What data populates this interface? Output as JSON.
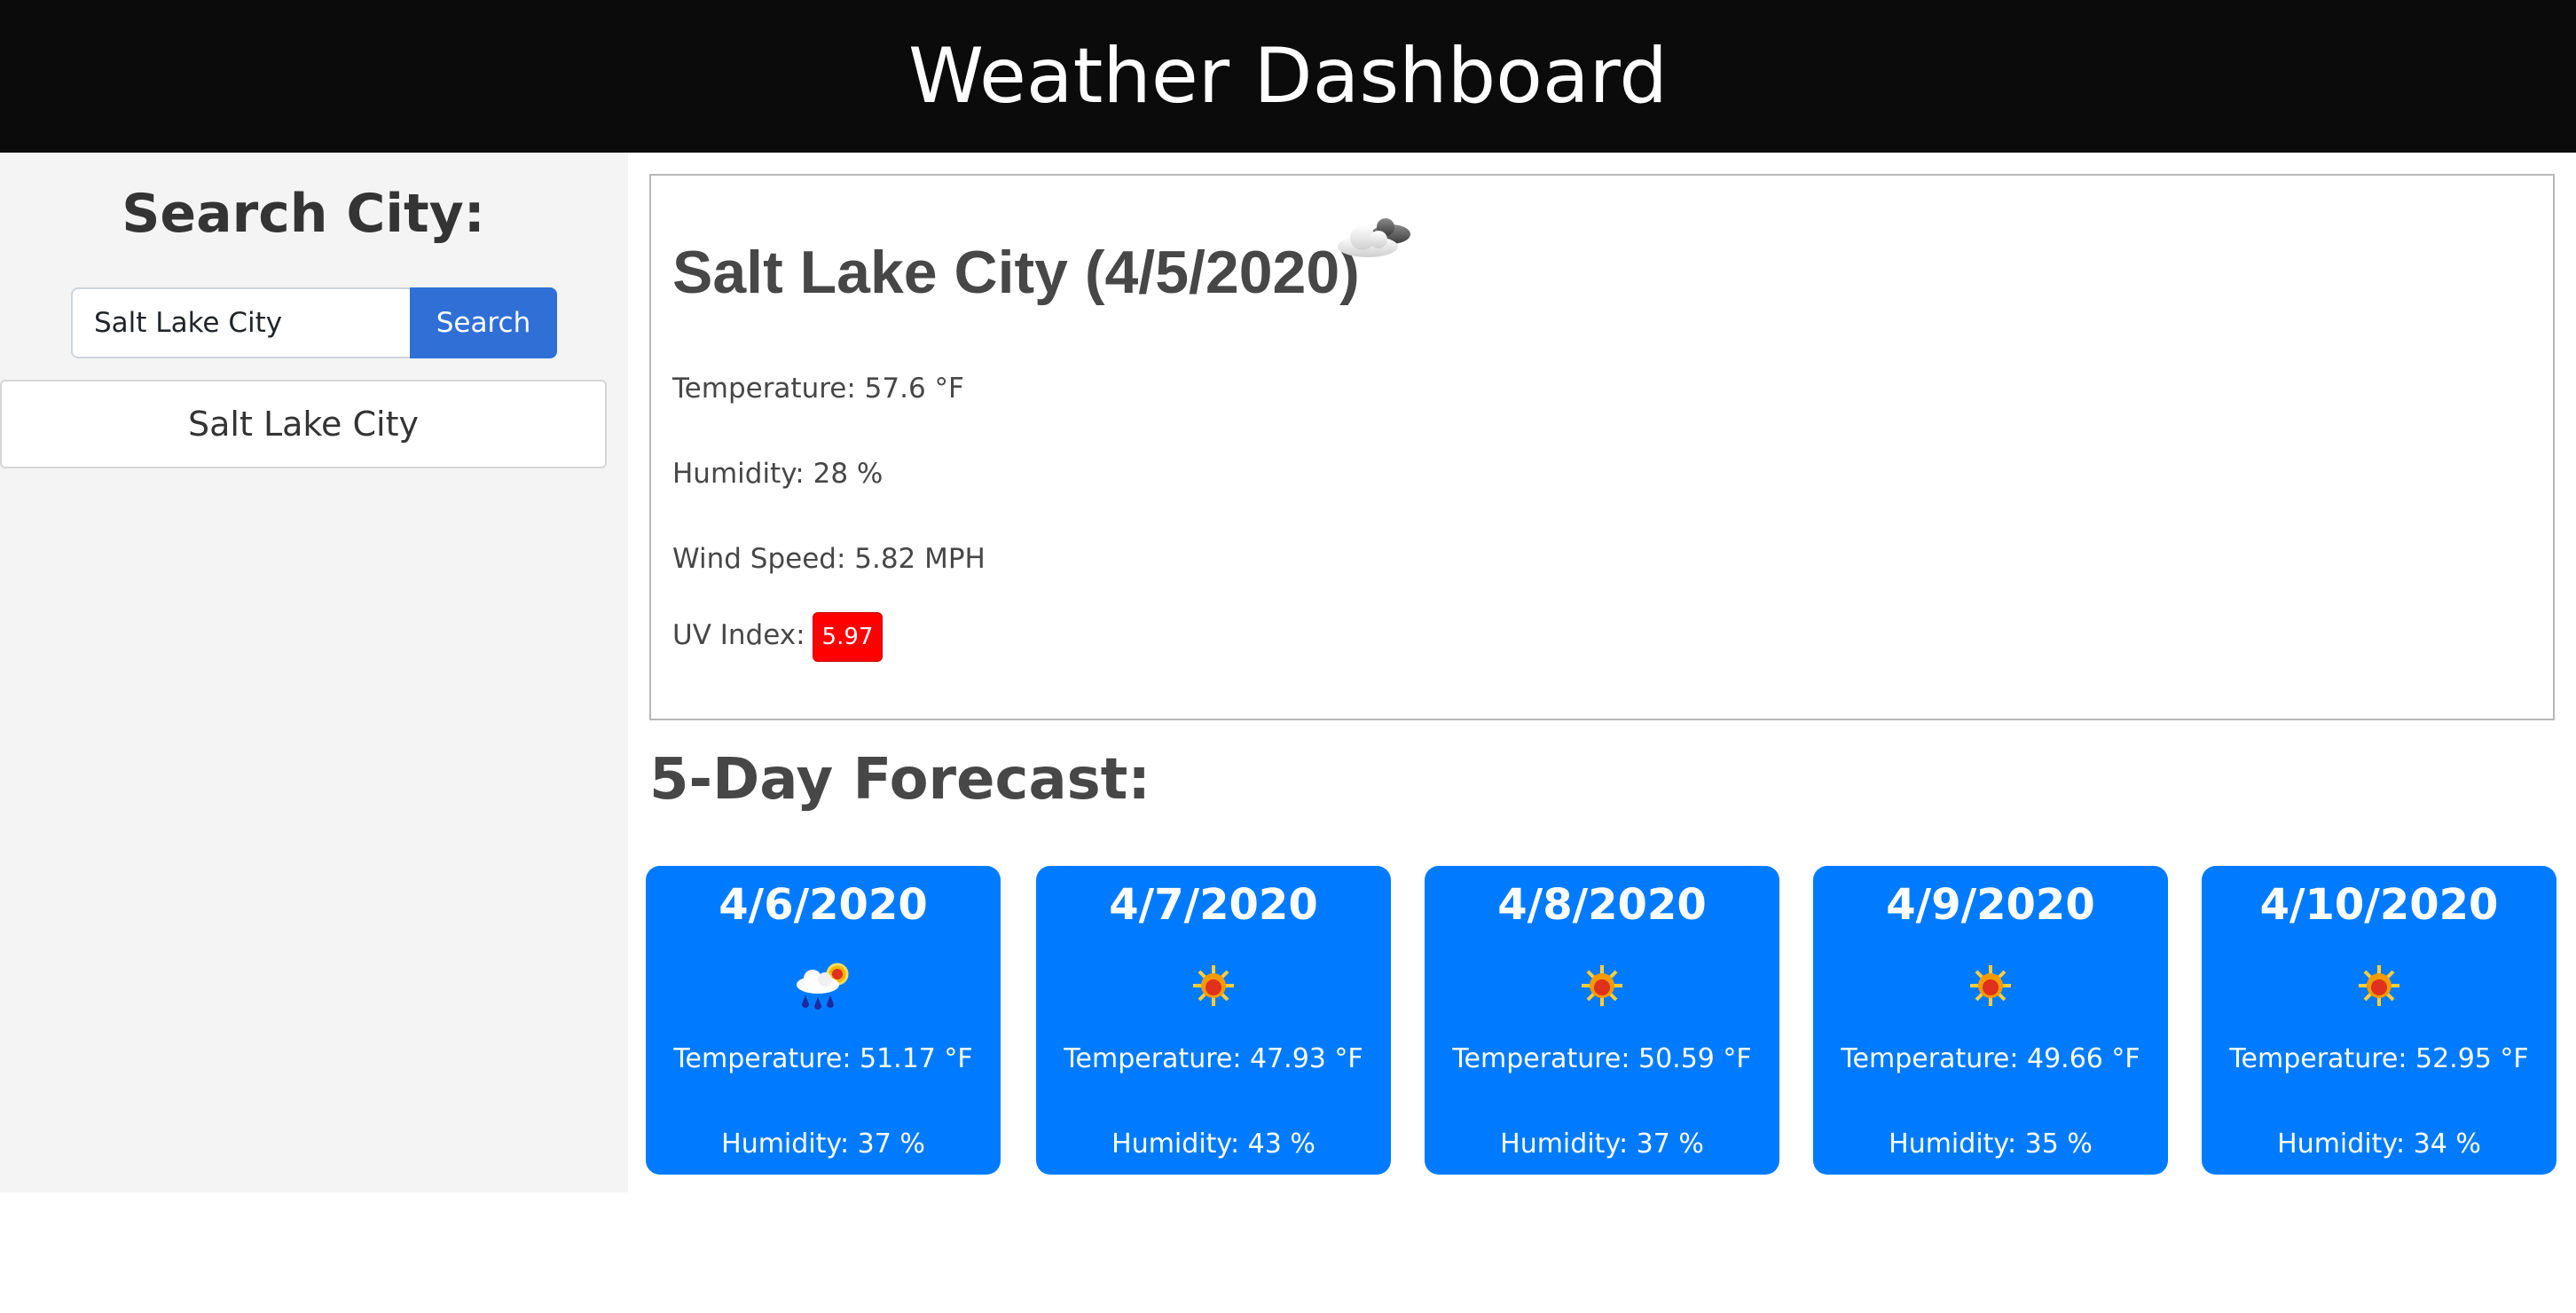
{
  "header": {
    "title": "Weather Dashboard"
  },
  "sidebar": {
    "heading": "Search City:",
    "search_value": "Salt Lake City",
    "search_button": "Search",
    "history": [
      "Salt Lake City"
    ]
  },
  "current": {
    "title": "Salt Lake City (4/5/2020)",
    "icon": "cloud-icon",
    "temperature": "Temperature: 57.6 °F",
    "humidity": "Humidity: 28 %",
    "wind": "Wind Speed: 5.82 MPH",
    "uv_label": "UV Index:",
    "uv_value": "5.97",
    "uv_color": "#ff0000"
  },
  "forecast": {
    "title": "5-Day Forecast:",
    "card_color": "#007bff",
    "days": [
      {
        "date": "4/6/2020",
        "icon": "rain-sun-icon",
        "temperature": "Temperature: 51.17 °F",
        "humidity": "Humidity: 37 %"
      },
      {
        "date": "4/7/2020",
        "icon": "sun-icon",
        "temperature": "Temperature: 47.93 °F",
        "humidity": "Humidity: 43 %"
      },
      {
        "date": "4/8/2020",
        "icon": "sun-icon",
        "temperature": "Temperature: 50.59 °F",
        "humidity": "Humidity: 37 %"
      },
      {
        "date": "4/9/2020",
        "icon": "sun-icon",
        "temperature": "Temperature: 49.66 °F",
        "humidity": "Humidity: 35 %"
      },
      {
        "date": "4/10/2020",
        "icon": "sun-icon",
        "temperature": "Temperature: 52.95 °F",
        "humidity": "Humidity: 34 %"
      }
    ]
  }
}
